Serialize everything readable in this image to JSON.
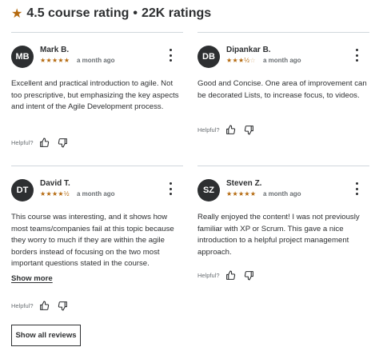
{
  "header": {
    "rating": "4.5 course rating",
    "separator": "•",
    "count": "22K ratings"
  },
  "reviews": [
    {
      "initials": "MB",
      "name": "Mark B.",
      "stars_full": "★★★★★",
      "stars_empty": "",
      "rating": 5,
      "when": "a month ago",
      "text": "Excellent and practical introduction to agile. Not too prescriptive, but emphasizing the key aspects and intent of the Agile Development process.",
      "helpful_label": "Helpful?"
    },
    {
      "initials": "DB",
      "name": "Dipankar B.",
      "stars_full": "★★★½",
      "stars_empty": "☆",
      "rating": 3.5,
      "when": "a month ago",
      "text": "Good and Concise. One area of improvement can be decorated Lists, to increase focus, to videos.",
      "helpful_label": "Helpful?"
    },
    {
      "initials": "DT",
      "name": "David T.",
      "stars_full": "★★★★½",
      "stars_empty": "",
      "rating": 4.5,
      "when": "a month ago",
      "text": "This course was interesting, and it shows how most teams/companies fail at this topic because they worry to much if they are within the agile borders instead of focusing on the two most important questions stated in the course.",
      "show_more": "Show more",
      "helpful_label": "Helpful?"
    },
    {
      "initials": "SZ",
      "name": "Steven Z.",
      "stars_full": "★★★★★",
      "stars_empty": "",
      "rating": 5,
      "when": "a month ago",
      "text": "Really enjoyed the content! I was not previously familiar with XP or Scrum. This gave a nice introduction to a helpful project management approach.",
      "helpful_label": "Helpful?"
    }
  ],
  "show_all_label": "Show all reviews",
  "colors": {
    "star": "#b4690e",
    "avatar_bg": "#2d2f31",
    "text": "#2d2f31",
    "muted": "#6a6f73",
    "divider": "#d1d7dc"
  },
  "icons": [
    "star-icon",
    "kebab-menu-icon",
    "thumbs-up-icon",
    "thumbs-down-icon"
  ]
}
